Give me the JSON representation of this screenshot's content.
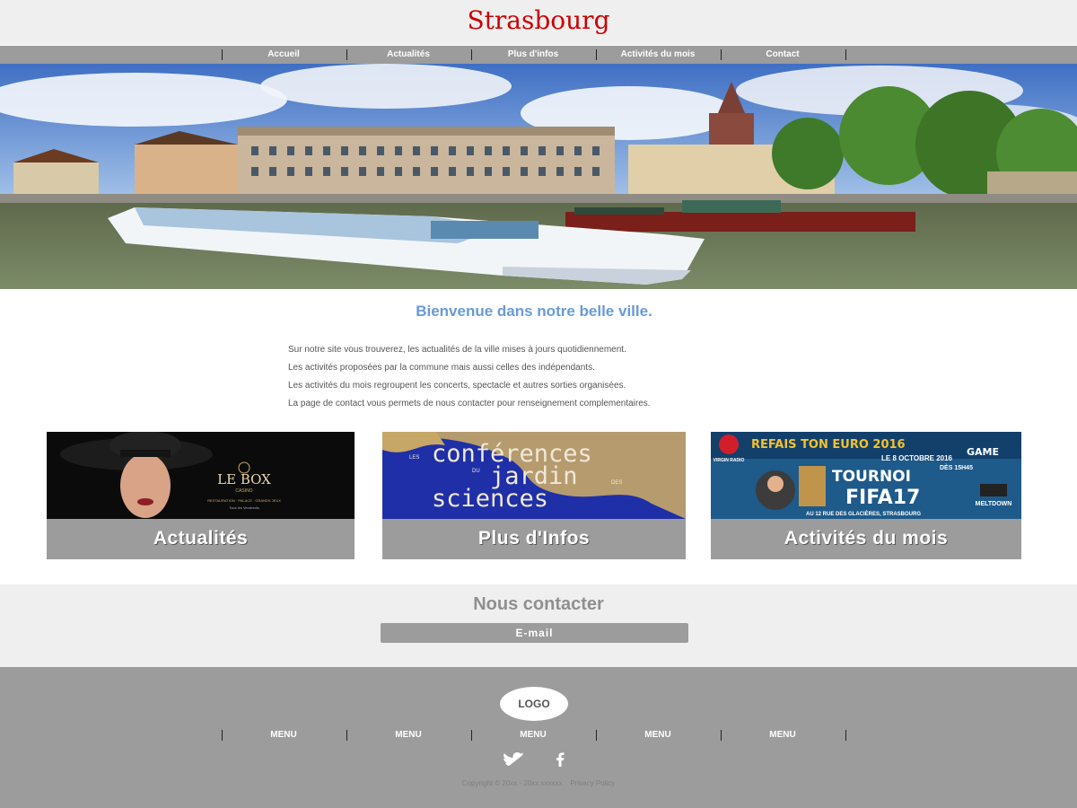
{
  "header": {
    "title": "Strasbourg"
  },
  "nav": {
    "items": [
      "Accueil",
      "Actualités",
      "Plus d'infos",
      "Activités du mois",
      "Contact"
    ]
  },
  "welcome": {
    "title": "Bienvenue dans notre belle ville.",
    "paragraphs": [
      "Sur notre site vous trouverez, les actualités de la ville mises à jours quotidiennement.",
      "Les activités proposées par la commune mais aussi celles des indépendants.",
      "Les activités du mois regroupent les concerts, spectacle et autres sorties organisées.",
      "La page de contact vous permets de nous contacter pour renseignement complementaires."
    ]
  },
  "cards": [
    {
      "label": "Actualités",
      "image_text": {
        "brand": "LE BOX",
        "sub": "CASINO",
        "tag": "RESTAURATION · PALACE · GRANDS JEUX",
        "line": "Tous les Vendredis"
      }
    },
    {
      "label": "Plus d'Infos",
      "image_text": {
        "les": "LES",
        "l1": "conférences",
        "du": "DU",
        "l2": "jardin",
        "des": "DES",
        "l3": "sciences"
      }
    },
    {
      "label": "Activités du mois",
      "image_text": {
        "headline": "REFAIS TON EURO 2016",
        "date": "LE 8 OCTOBRE 2016",
        "time": "DÈS 15H45",
        "event": "TOURNOI",
        "game": "FIFA17",
        "brand1": "GAME",
        "brand2": "MELTDOWN",
        "radio": "VIRGIN RADIO",
        "venue": "AU 12 RUE DES GLACIÈRES, STRASBOURG"
      }
    }
  ],
  "contact": {
    "title": "Nous contacter",
    "button": "E-mail"
  },
  "footer": {
    "logo": "LOGO",
    "menu": [
      "MENU",
      "MENU",
      "MENU",
      "MENU",
      "MENU"
    ],
    "social": [
      "twitter-icon",
      "facebook-icon"
    ],
    "copyright": "Copyright © 20xx - 20xx xxxxxx",
    "privacy": "Privacy Policy"
  },
  "colors": {
    "title": "#cc0000",
    "nav": "#9c9c9c",
    "welcome": "#6a9ad8",
    "panel": "#efefef"
  }
}
